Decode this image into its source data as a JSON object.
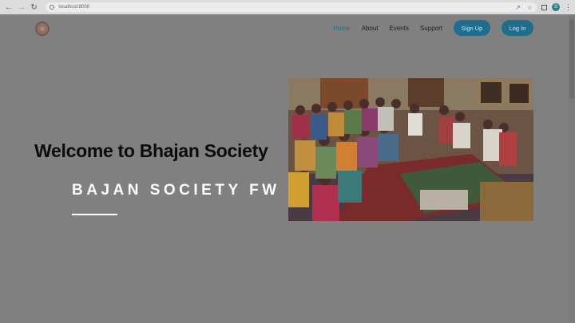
{
  "browser": {
    "url": "localhost:8000",
    "avatar_letter": "S"
  },
  "site": {
    "nav": {
      "items": [
        {
          "label": "Home",
          "active": true
        },
        {
          "label": "About",
          "active": false
        },
        {
          "label": "Events",
          "active": false
        },
        {
          "label": "Support",
          "active": false
        }
      ],
      "signup_label": "Sign Up",
      "login_label": "Log In"
    },
    "hero": {
      "title": "Welcome to Bhajan Society",
      "subtitle": "BAJAN SOCIETY FW",
      "image_alt": "Group of people seated on the floor at a bhajan gathering"
    }
  },
  "colors": {
    "accent": "#1f6e8e",
    "overlay": "#808080",
    "title": "#0b0b0b",
    "subtitle": "#ffffff"
  }
}
